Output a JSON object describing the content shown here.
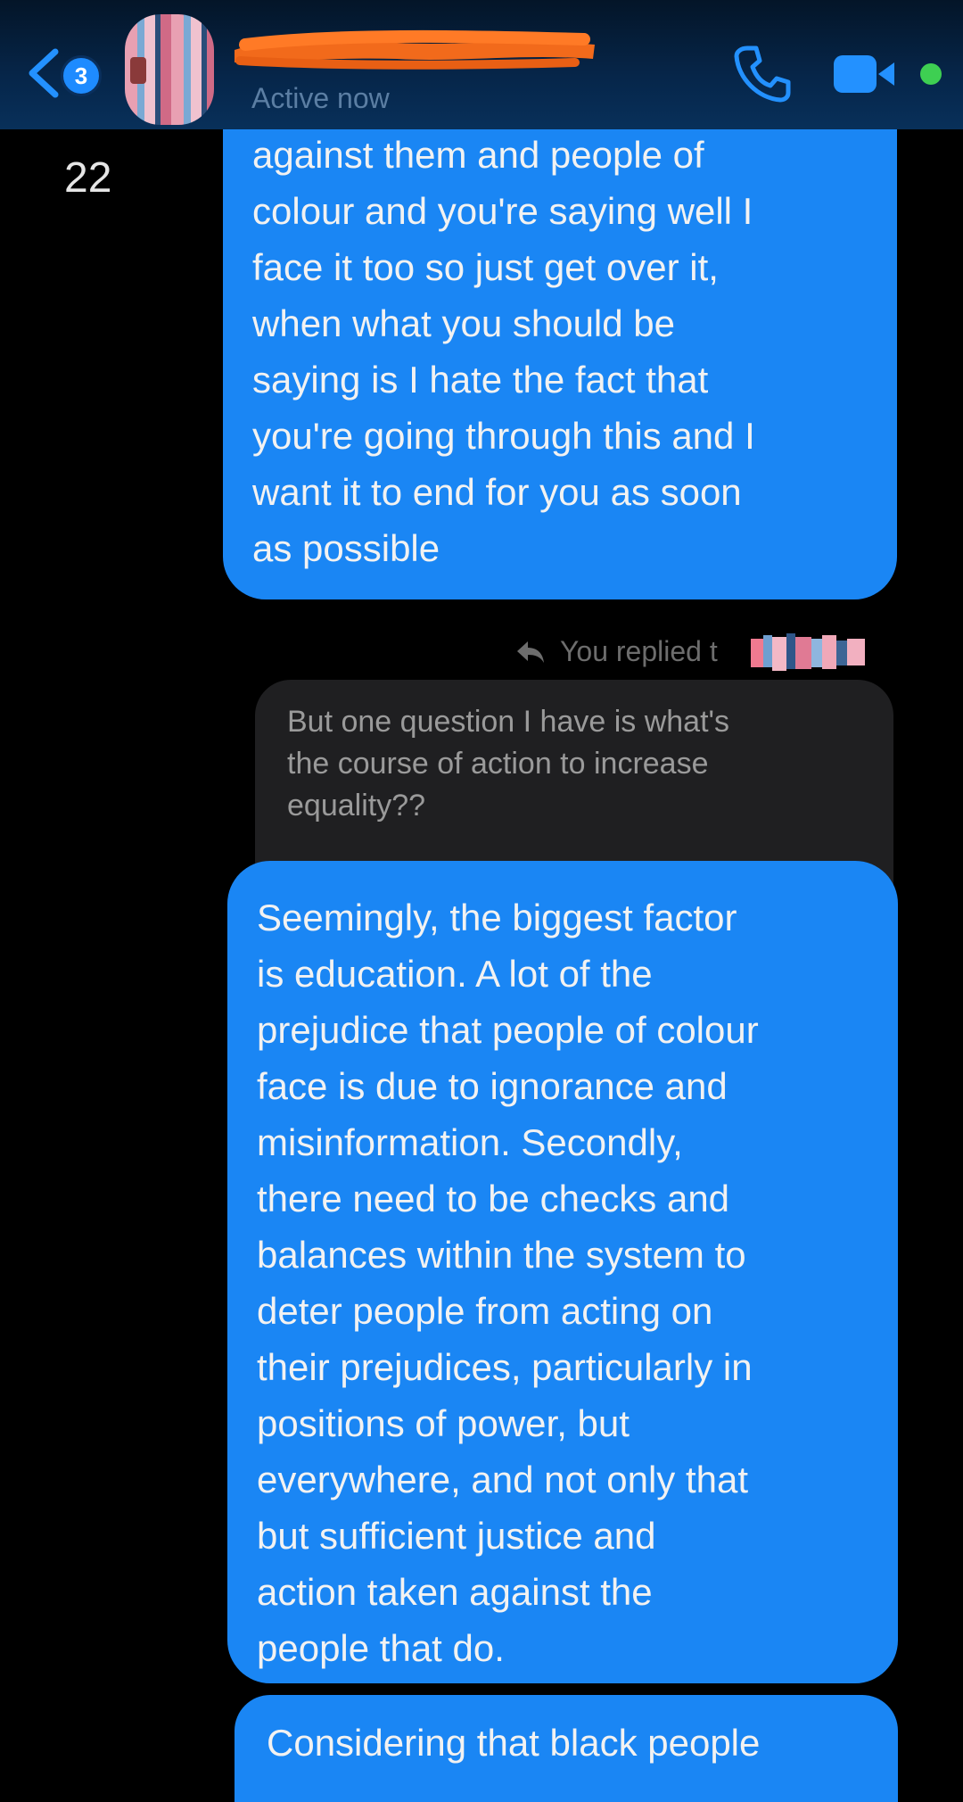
{
  "header": {
    "back_badge_count": "3",
    "status": "Active now"
  },
  "thread": {
    "timestamp_left": "22",
    "messages": [
      {
        "text": "against them and people of\ncolour and you're saying well I\nface it too so just get over it,\nwhen what you should be\nsaying is I hate the fact that\nyou're going through this and I\nwant it to end for you as soon\nas possible"
      },
      {
        "reply_label": "You replied t",
        "quoted_text": "But one question I have is what's\nthe course of action to increase\nequality??",
        "text": "Seemingly, the biggest factor\nis education. A lot of the\nprejudice that people of colour\nface is due to ignorance and\nmisinformation. Secondly,\nthere need to be checks and\nbalances within the system to\ndeter people from acting on\ntheir prejudices, particularly in\npositions of power, but\neverywhere, and not only that\nbut sufficient justice and\naction taken against the\npeople that do."
      },
      {
        "text": "Considering that black people"
      }
    ]
  },
  "colors": {
    "header_bg": "#06264a",
    "outgoing_bubble": "#1a86f4",
    "quoted_bubble": "#1f1f21",
    "accent": "#2391ff",
    "online": "#3ecf52",
    "redaction": "#f26a1b"
  },
  "icons": {
    "back": "chevron-left-icon",
    "call": "phone-icon",
    "video": "video-camera-icon",
    "reply": "reply-arrow-icon"
  }
}
